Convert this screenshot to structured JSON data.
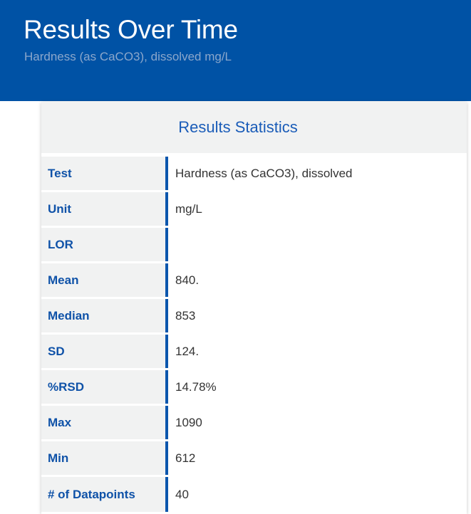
{
  "header": {
    "title": "Results Over Time",
    "subtitle": "Hardness (as CaCO3), dissolved mg/L",
    "background_color": "#0052a5",
    "title_color": "#ffffff",
    "subtitle_color": "#8ba7cb"
  },
  "card": {
    "title": "Results Statistics",
    "title_color": "#1a5cb8",
    "header_background": "#f1f2f2",
    "label_color": "#0f52a8",
    "accent_bar_color": "#0b56ad",
    "value_color": "#333333"
  },
  "stats": {
    "rows": [
      {
        "label": "Test",
        "value": "Hardness (as CaCO3), dissolved"
      },
      {
        "label": "Unit",
        "value": "mg/L"
      },
      {
        "label": "LOR",
        "value": ""
      },
      {
        "label": "Mean",
        "value": "840."
      },
      {
        "label": "Median",
        "value": "853"
      },
      {
        "label": "SD",
        "value": "124."
      },
      {
        "label": "%RSD",
        "value": "14.78%"
      },
      {
        "label": "Max",
        "value": "1090"
      },
      {
        "label": "Min",
        "value": "612"
      },
      {
        "label": "# of Datapoints",
        "value": "40"
      }
    ]
  }
}
